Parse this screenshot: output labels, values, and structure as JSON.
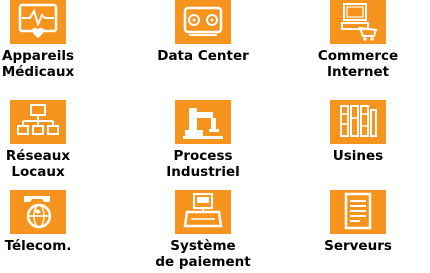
{
  "colors": {
    "accent": "#f7941d",
    "icon_line": "#ffffff",
    "text": "#000000"
  },
  "items": [
    {
      "name": "appareils-medicaux",
      "icon": "medical-monitor-icon",
      "line1": "Appareils",
      "line2": "Médicaux"
    },
    {
      "name": "data-center",
      "icon": "server-storage-icon",
      "line1": "Data Center",
      "line2": ""
    },
    {
      "name": "commerce-internet",
      "icon": "computer-shopping-icon",
      "line1": "Commerce",
      "line2": "Internet"
    },
    {
      "name": "reseaux-locaux",
      "icon": "network-hierarchy-icon",
      "line1": "Réseaux",
      "line2": "Locaux"
    },
    {
      "name": "process-industriel",
      "icon": "robot-arm-icon",
      "line1": "Process",
      "line2": "Industriel"
    },
    {
      "name": "usines",
      "icon": "factory-racks-icon",
      "line1": "Usines",
      "line2": ""
    },
    {
      "name": "telecom",
      "icon": "phone-globe-icon",
      "line1": "Télecom.",
      "line2": ""
    },
    {
      "name": "systeme-de-paiement",
      "icon": "payment-terminal-icon",
      "line1": "Système",
      "line2": "de paiement"
    },
    {
      "name": "serveurs",
      "icon": "server-rack-icon",
      "line1": "Serveurs",
      "line2": ""
    }
  ]
}
